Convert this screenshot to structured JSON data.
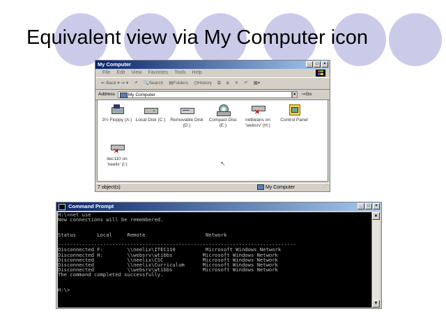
{
  "slide": {
    "title": "Equivalent view via My Computer icon"
  },
  "explorer": {
    "title": "My Computer",
    "menu": [
      "File",
      "Edit",
      "View",
      "Favorites",
      "Tools",
      "Help"
    ],
    "toolbar": [
      "Back",
      "Search",
      "Folders",
      "History"
    ],
    "address_label": "Address",
    "address_value": "My Computer",
    "go_label": "Go",
    "items": [
      {
        "label": "3½ Floppy (A:)",
        "icon": "floppy-drive-icon"
      },
      {
        "label": "Local Disk (C:)",
        "icon": "hard-disk-icon"
      },
      {
        "label": "Removable Disk (D:)",
        "icon": "removable-disk-icon"
      },
      {
        "label": "Compact Disc (E:)",
        "icon": "cd-drive-icon"
      },
      {
        "label": "netbeans on 'websrv' (H:)",
        "icon": "disconnected-network-drive-icon"
      },
      {
        "label": "Control Panel",
        "icon": "control-panel-icon"
      },
      {
        "label": "itec110 on 'neelix' (I:)",
        "icon": "disconnected-network-drive-icon"
      }
    ],
    "status_count": "7 object(s)",
    "status_location": "My Computer"
  },
  "cmd": {
    "title": "Command Prompt",
    "lines": [
      "H:\\>net use",
      "New connections will be remembered.",
      "",
      "",
      "Status       Local     Remote                    Network",
      "",
      "-------------------------------------------------------------------------------",
      "Disconnected F:        \\\\neelix\\ITEC110          Microsoft Windows Network",
      "Disconnected H:        \\\\websrv\\wtibbs          Microsoft Windows Network",
      "Disconnected           \\\\neelix\\CSC             Microsoft Windows Network",
      "Disconnected           \\\\neelix\\Curriculum      Microsoft Windows Network",
      "Disconnected           \\\\websrv\\wtibbs          Microsoft Windows Network",
      "The command completed successfully.",
      "",
      "",
      "H:\\>"
    ]
  }
}
